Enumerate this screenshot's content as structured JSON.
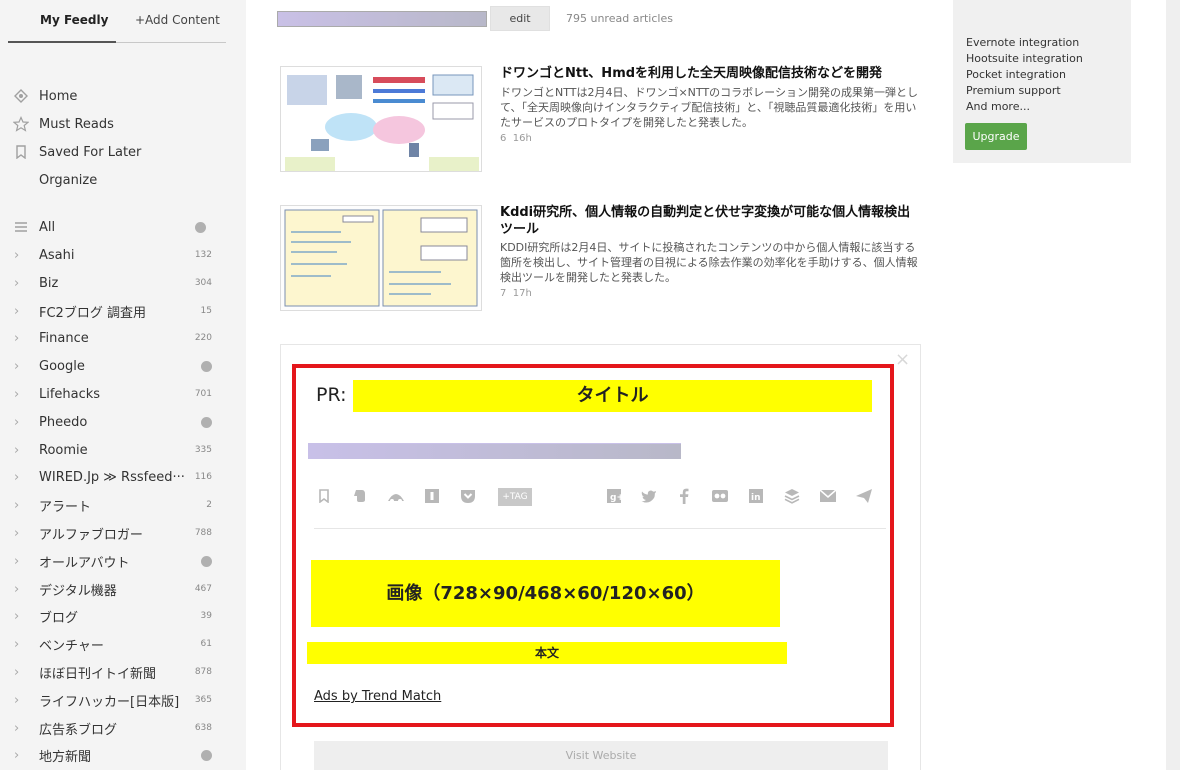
{
  "sidebar": {
    "tab_active": "My Feedly",
    "tab_add": "+Add Content",
    "nav": [
      {
        "label": "Home",
        "icon": "home-icon"
      },
      {
        "label": "Must Reads",
        "icon": "star-icon"
      },
      {
        "label": "Saved For Later",
        "icon": "bookmark-icon"
      },
      {
        "label": "Organize",
        "icon": ""
      }
    ],
    "all": {
      "label": "All",
      "icon": "list-icon"
    },
    "feeds": [
      {
        "label": "Asahi",
        "count": "132"
      },
      {
        "label": "Biz",
        "count": "304"
      },
      {
        "label": "FC2ブログ 調査用",
        "count": "15"
      },
      {
        "label": "Finance",
        "count": "220"
      },
      {
        "label": "Google",
        "count": ""
      },
      {
        "label": "Lifehacks",
        "count": "701"
      },
      {
        "label": "Pheedo",
        "count": ""
      },
      {
        "label": "Roomie",
        "count": "335"
      },
      {
        "label": "WIRED.Jp ≫ Rssfeed···",
        "count": "116"
      },
      {
        "label": "アラート",
        "count": "2"
      },
      {
        "label": "アルファブロガー",
        "count": "788"
      },
      {
        "label": "オールアバウト",
        "count": ""
      },
      {
        "label": "デジタル機器",
        "count": "467"
      },
      {
        "label": "ブログ",
        "count": "39"
      },
      {
        "label": "ベンチャー",
        "count": "61"
      },
      {
        "label": "ほぼ日刊イトイ新聞",
        "count": "878"
      },
      {
        "label": "ライフハッカー[日本版]",
        "count": "365"
      },
      {
        "label": "広告系ブログ",
        "count": "638"
      },
      {
        "label": "地方新聞",
        "count": ""
      }
    ]
  },
  "topbar": {
    "edit_label": "edit",
    "unread": "795 unread articles",
    "icons": [
      "check-icon",
      "refresh-icon",
      "settings-icon",
      "collapse-up-icon"
    ]
  },
  "articles": [
    {
      "title": "ドワンゴとNtt、Hmdを利用した全天周映像配信技術などを開発",
      "body": "ドワンゴとNTTは2月4日、ドワンゴ×NTTのコラボレーション開発の成果第一弾として、「全天周映像向けインタラクティブ配信技術」と、「視聴品質最適化技術」を用いたサービスのプロトタイプを開発したと発表した。",
      "count": "6",
      "age": "16h"
    },
    {
      "title": "Kddi研究所、個人情報の自動判定と伏せ字変換が可能な個人情報検出ツール",
      "body": "KDDI研究所は2月4日、サイトに投稿されたコンテンツの中から個人情報に該当する箇所を検出し、サイト管理者の目視による除去作業の効率化を手助けする、個人情報検出ツールを開発したと発表した。",
      "count": "7",
      "age": "17h"
    }
  ],
  "promo": {
    "lines": [
      "Evernote integration",
      "Hootsuite integration",
      "Pocket integration",
      "Premium support",
      "And more..."
    ],
    "upgrade": "Upgrade"
  },
  "ad": {
    "close": "×",
    "pr_label": "PR:",
    "title": "タイトル",
    "image_label": "画像（728×90/468×60/120×60）",
    "body_label": "本文",
    "ads_by": "Ads by Trend Match",
    "visit": "Visit Website",
    "tag_label": "+TAG"
  },
  "colors": {
    "sidebar_bg": "#f4f4f4",
    "highlight_yellow": "#ffff00",
    "frame_red": "#e4161b",
    "upgrade_green": "#5aa54a"
  }
}
